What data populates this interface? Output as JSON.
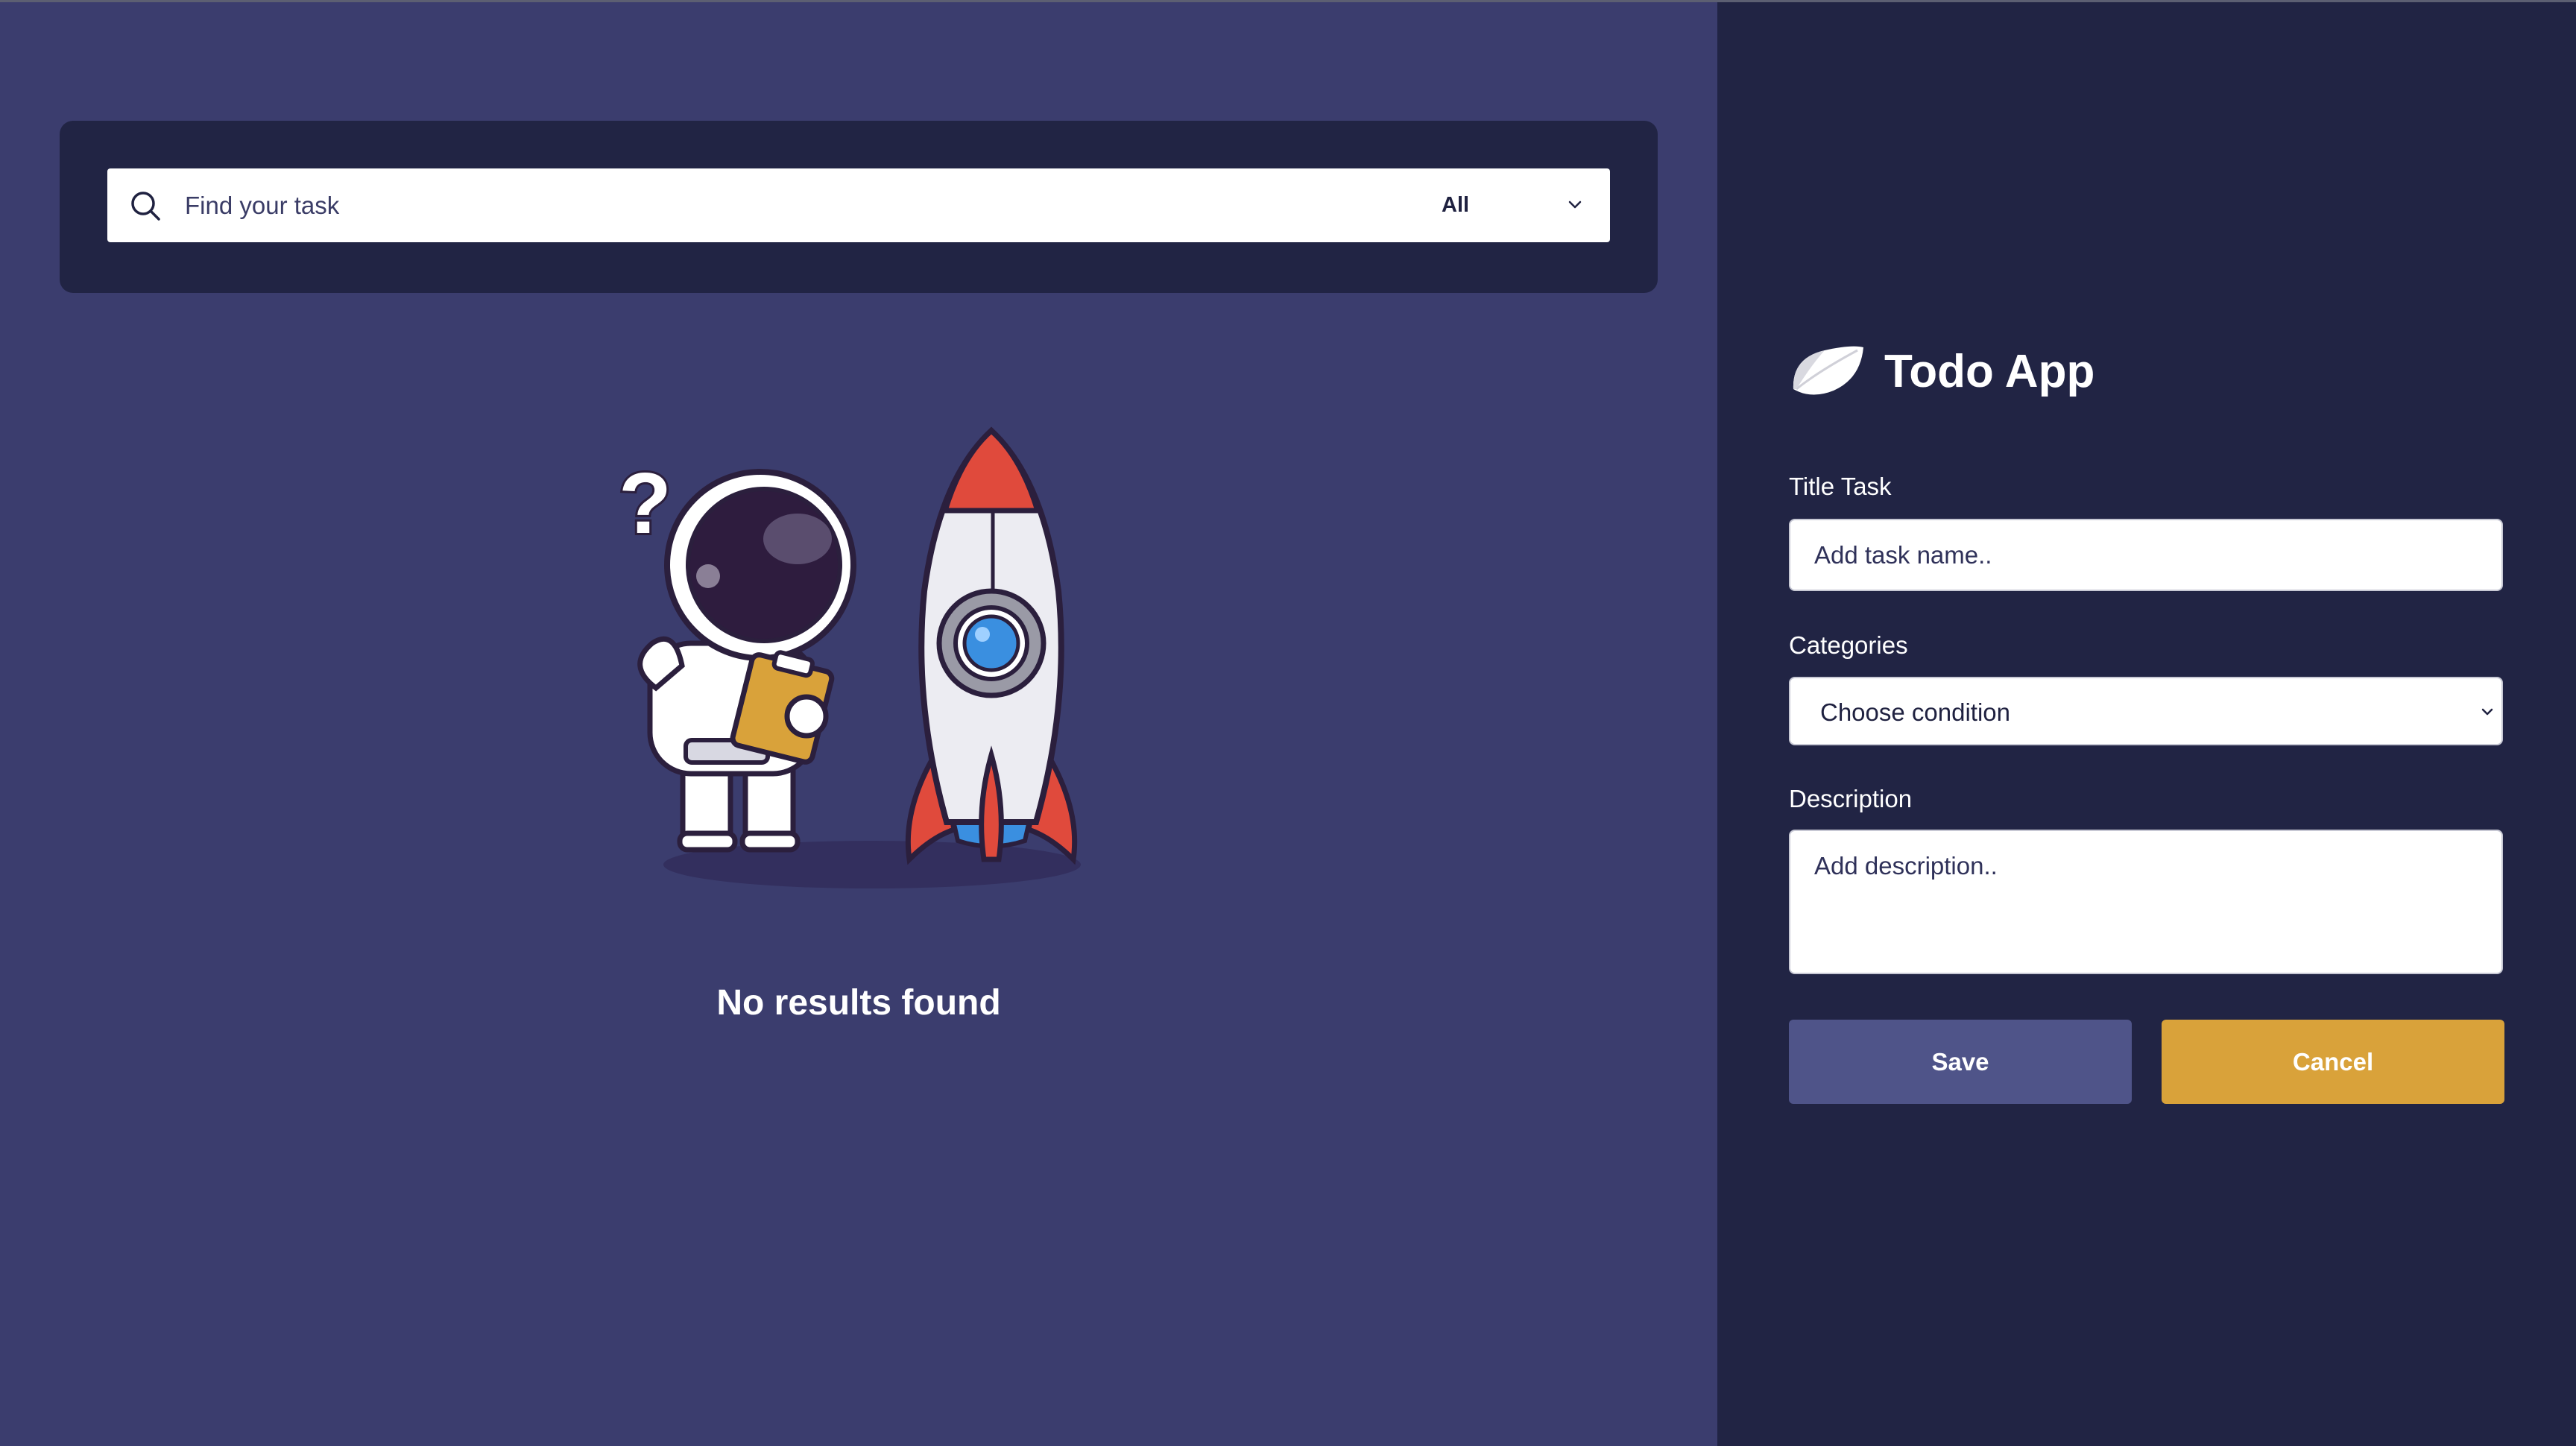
{
  "search": {
    "placeholder": "Find your task",
    "filter_value": "All",
    "icon": "search-icon"
  },
  "empty_state": {
    "message": "No results found",
    "illustration": "astronaut-with-rocket"
  },
  "sidebar": {
    "app_title": "Todo App",
    "logo": "leaf-logo",
    "form": {
      "title_label": "Title Task",
      "title_placeholder": "Add task name..",
      "category_label": "Categories",
      "category_value": "Choose condition",
      "description_label": "Description",
      "description_placeholder": "Add description..",
      "save_label": "Save",
      "cancel_label": "Cancel"
    }
  },
  "colors": {
    "main_bg": "#3b3d6e",
    "sidebar_bg": "#212444",
    "save_button": "#4f5489",
    "cancel_button": "#d9a23a"
  }
}
